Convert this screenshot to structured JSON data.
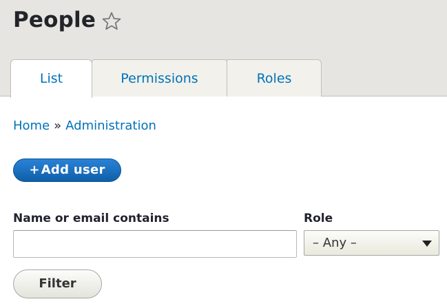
{
  "header": {
    "title": "People",
    "favorite_icon": "star-outline-icon"
  },
  "tabs": [
    {
      "label": "List",
      "active": true
    },
    {
      "label": "Permissions",
      "active": false
    },
    {
      "label": "Roles",
      "active": false
    }
  ],
  "breadcrumb": {
    "items": [
      "Home",
      "Administration"
    ],
    "separator": "»"
  },
  "actions": {
    "add_user_icon": "+",
    "add_user_label": "Add user"
  },
  "filters": {
    "name_label": "Name or email contains",
    "name_value": "",
    "role_label": "Role",
    "role_selected": "– Any –",
    "submit_label": "Filter"
  },
  "colors": {
    "link": "#0072b9",
    "primary_button": "#1d6fbd",
    "header_bg": "#e7e5e1"
  }
}
